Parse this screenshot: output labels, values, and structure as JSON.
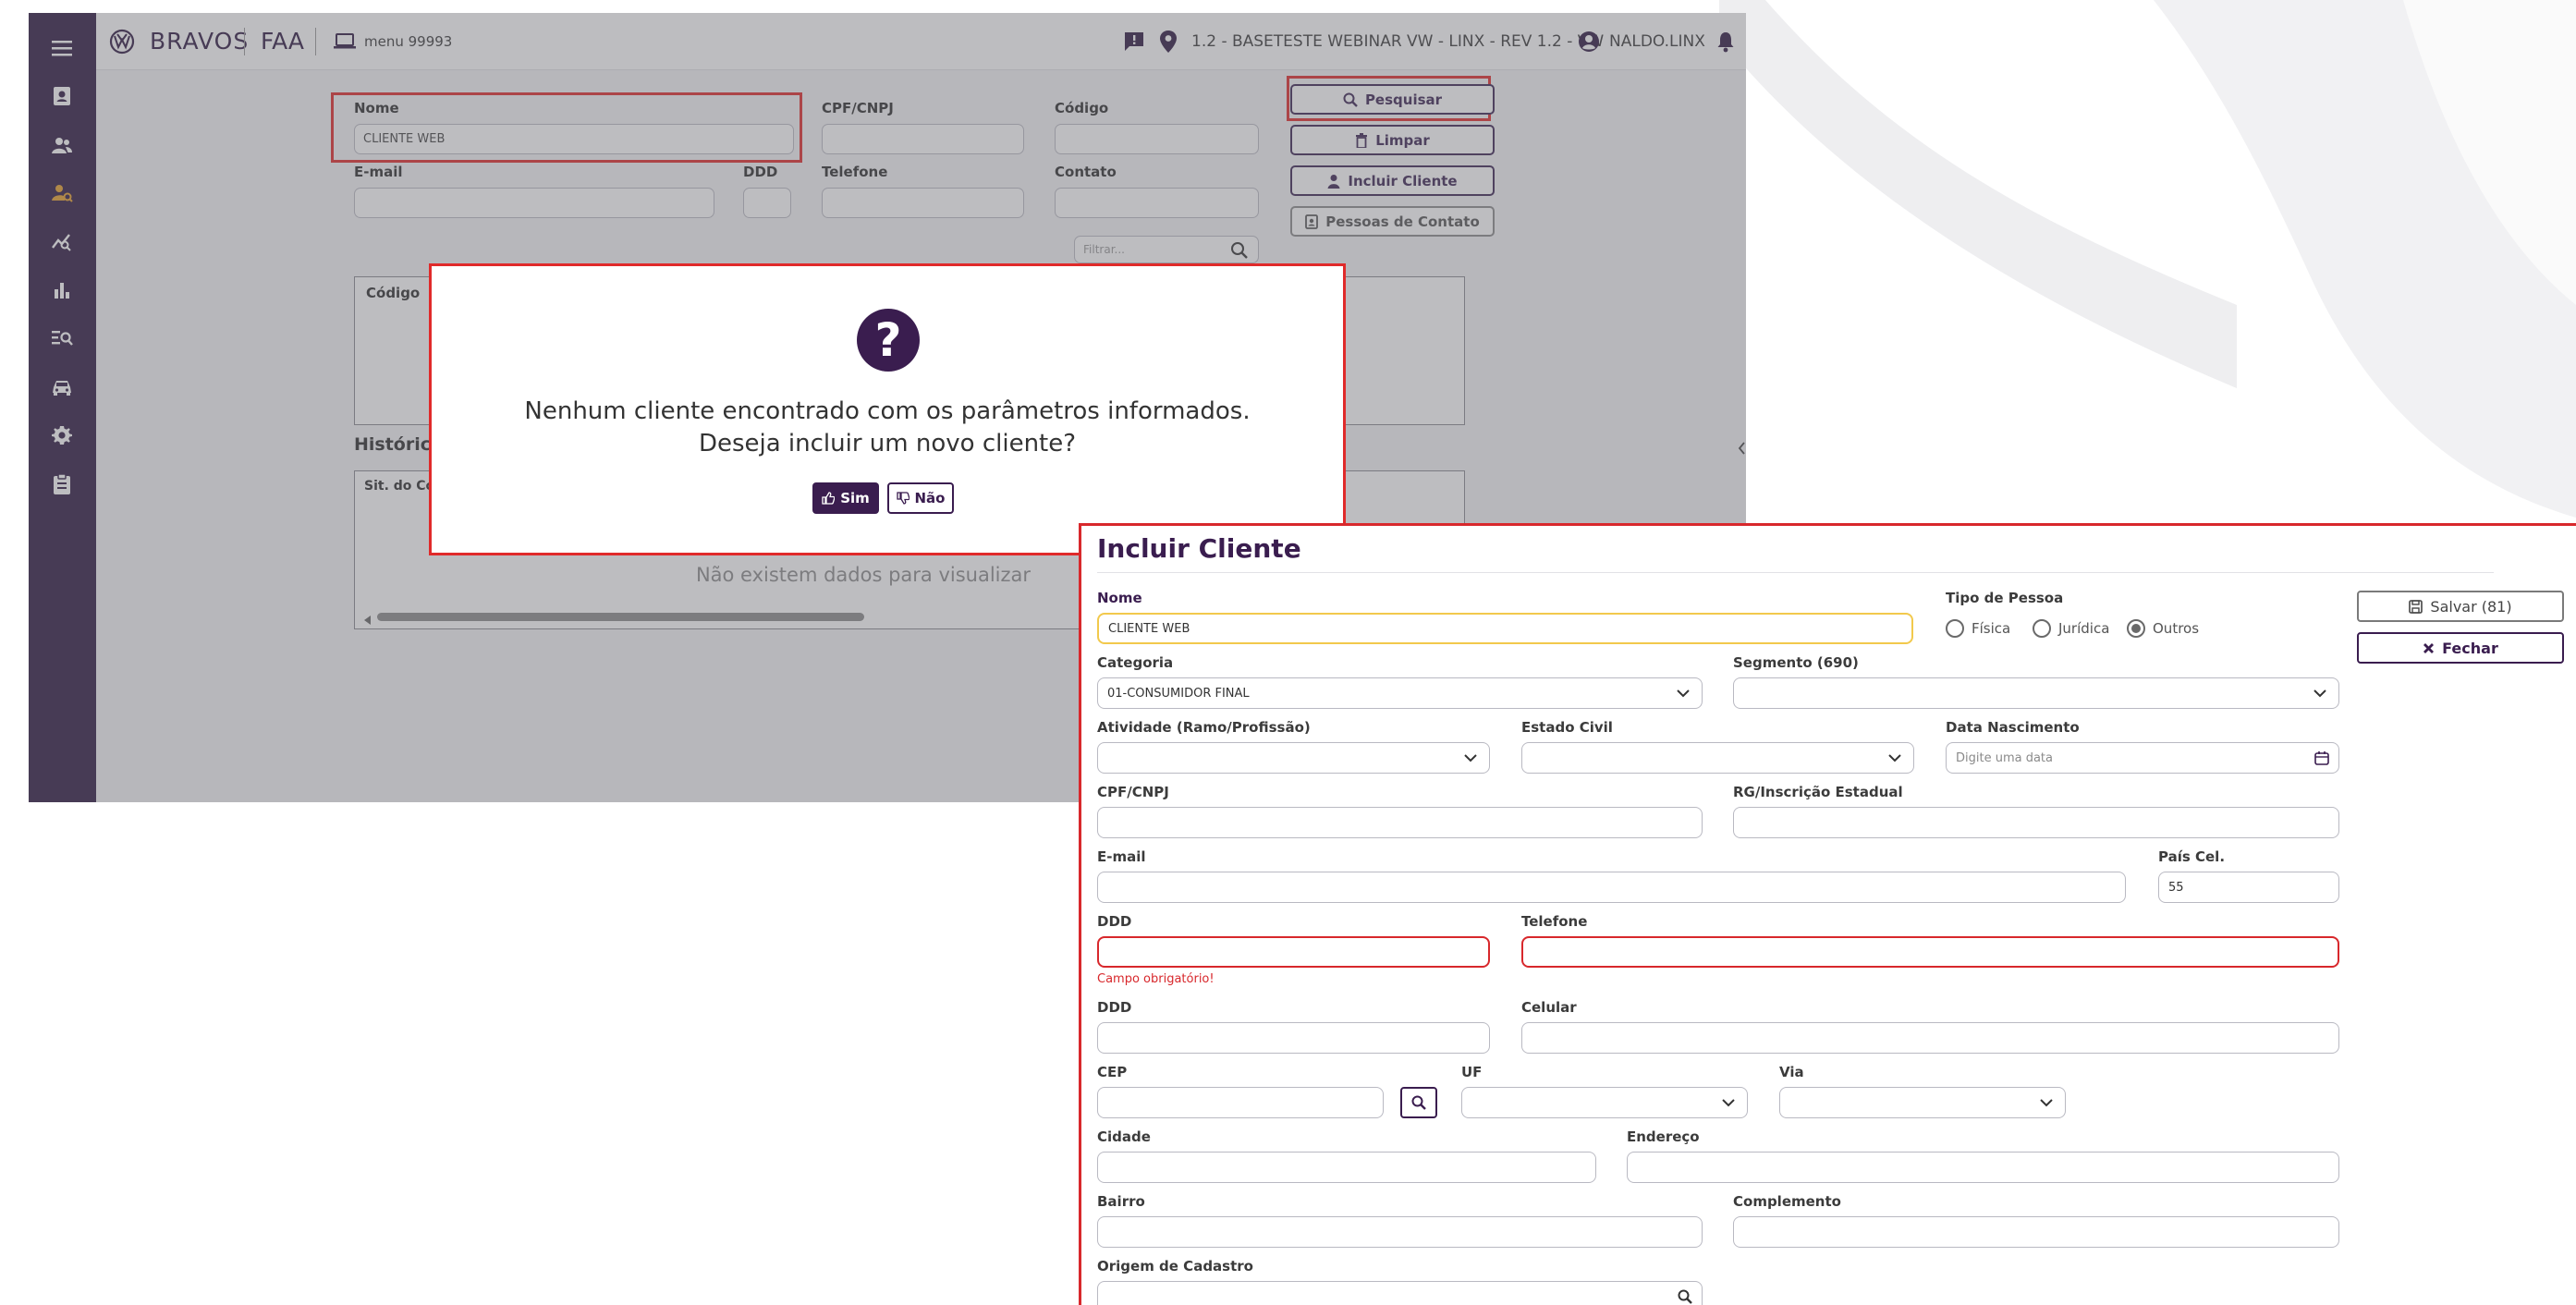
{
  "app": {
    "brand": "BRAVOS",
    "module": "FAA",
    "menu_label": "menu 99993",
    "location": "1.2 - BASETESTE WEBINAR VW - LINX - REV 1.2 - VW",
    "user": "NALDO.LINX",
    "sidebar_icons": [
      "menu-icon",
      "contact-book-icon",
      "users-icon",
      "user-search-icon",
      "analytics-icon",
      "bar-chart-icon",
      "list-search-icon",
      "car-icon",
      "gear-icon",
      "clipboard-icon"
    ]
  },
  "search": {
    "nome_label": "Nome",
    "nome_value": "CLIENTE WEB",
    "cpf_label": "CPF/CNPJ",
    "codigo_label": "Código",
    "email_label": "E-mail",
    "ddd_label": "DDD",
    "telefone_label": "Telefone",
    "contato_label": "Contato",
    "filter_placeholder": "Filtrar...",
    "btn_pesquisar": "Pesquisar",
    "btn_limpar": "Limpar",
    "btn_incluir": "Incluir Cliente",
    "btn_pessoas": "Pessoas de Contato"
  },
  "results": {
    "col_codigo": "Código",
    "historico_title": "Histórico",
    "col_sit": "Sit. do Co",
    "empty_message": "Não existem dados para visualizar"
  },
  "dialog": {
    "line1": "Nenhum cliente encontrado com os parâmetros informados.",
    "line2": "Deseja incluir um novo cliente?",
    "yes": "Sim",
    "no": "Não"
  },
  "form": {
    "title": "Incluir Cliente",
    "nome_label": "Nome",
    "nome_value": "CLIENTE WEB",
    "tipo_label": "Tipo de Pessoa",
    "tipo_options": [
      "Física",
      "Jurídica",
      "Outros"
    ],
    "tipo_selected": "Outros",
    "salvar": "Salvar (81)",
    "fechar": "Fechar",
    "categoria_label": "Categoria",
    "categoria_value": "01-CONSUMIDOR FINAL",
    "segmento_label": "Segmento (690)",
    "atividade_label": "Atividade (Ramo/Profissão)",
    "estado_civil_label": "Estado Civil",
    "nascimento_label": "Data Nascimento",
    "nascimento_placeholder": "Digite uma data",
    "cpf_label": "CPF/CNPJ",
    "rg_label": "RG/Inscrição Estadual",
    "email_label": "E-mail",
    "pais_cel_label": "País Cel.",
    "pais_cel_value": "55",
    "ddd_label": "DDD",
    "telefone_label": "Telefone",
    "required_msg": "Campo obrigatório!",
    "ddd2_label": "DDD",
    "celular_label": "Celular",
    "cep_label": "CEP",
    "uf_label": "UF",
    "via_label": "Via",
    "cidade_label": "Cidade",
    "endereco_label": "Endereço",
    "bairro_label": "Bairro",
    "complemento_label": "Complemento",
    "origem_label": "Origem de Cadastro"
  }
}
